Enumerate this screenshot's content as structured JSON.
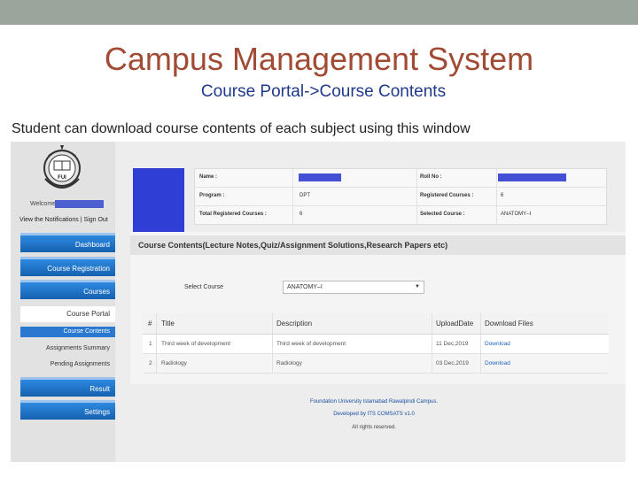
{
  "slide": {
    "title": "Campus Management System",
    "subtitle": "Course Portal->Course Contents",
    "caption": "Student can download course contents of each subject using this window"
  },
  "sidebar": {
    "logo_text": "FUI",
    "welcome": "Welcome",
    "notifications": "View the Notifications",
    "separator": "|",
    "sign_out": "Sign Out",
    "nav": {
      "dashboard": "Dashboard",
      "course_registration": "Course Registration",
      "courses": "Courses",
      "course_portal": "Course Portal",
      "course_contents": "Course Contents",
      "assignments_summary": "Assignments Summary",
      "pending_assignments": "Pending Assignments",
      "result": "Result",
      "settings": "Settings"
    }
  },
  "student_info": {
    "name_label": "Name :",
    "roll_label": "Roll No :",
    "program_label": "Program :",
    "program_value": "DPT",
    "registered_label": "Registered Courses :",
    "registered_value": "6",
    "total_label": "Total Registered Courses :",
    "total_value": "6",
    "selected_label": "Selected Course :",
    "selected_value": "ANATOMY–I"
  },
  "content": {
    "header": "Course Contents(Lecture Notes,Quiz/Assignment Solutions,Research Papers etc)",
    "select_label": "Select Course",
    "select_value": "ANATOMY–I",
    "table": {
      "headers": [
        "#",
        "Title",
        "Description",
        "UploadDate",
        "Download Files"
      ],
      "rows": [
        {
          "num": "1",
          "title": "Third week of development",
          "description": "Third week of development",
          "date": "11 Dec,2019",
          "link": "Download"
        },
        {
          "num": "2",
          "title": "Radiology",
          "description": "Radiology",
          "date": "03 Dec,2019",
          "link": "Download"
        }
      ]
    }
  },
  "footer": {
    "line1": "Foundation University Islamabad Rawalpindi Campus.",
    "line2": "Developed by ITS COMSATS v1.0",
    "line3": "All rights reserved."
  },
  "colors": {
    "title": "#a14b34",
    "subtitle": "#1f3a8a",
    "nav_blue": "#1f74cc",
    "redacted_blue": "#4350d6",
    "link": "#1a65c0"
  },
  "icons": [
    "university-logo-icon",
    "dropdown-arrow-icon"
  ]
}
